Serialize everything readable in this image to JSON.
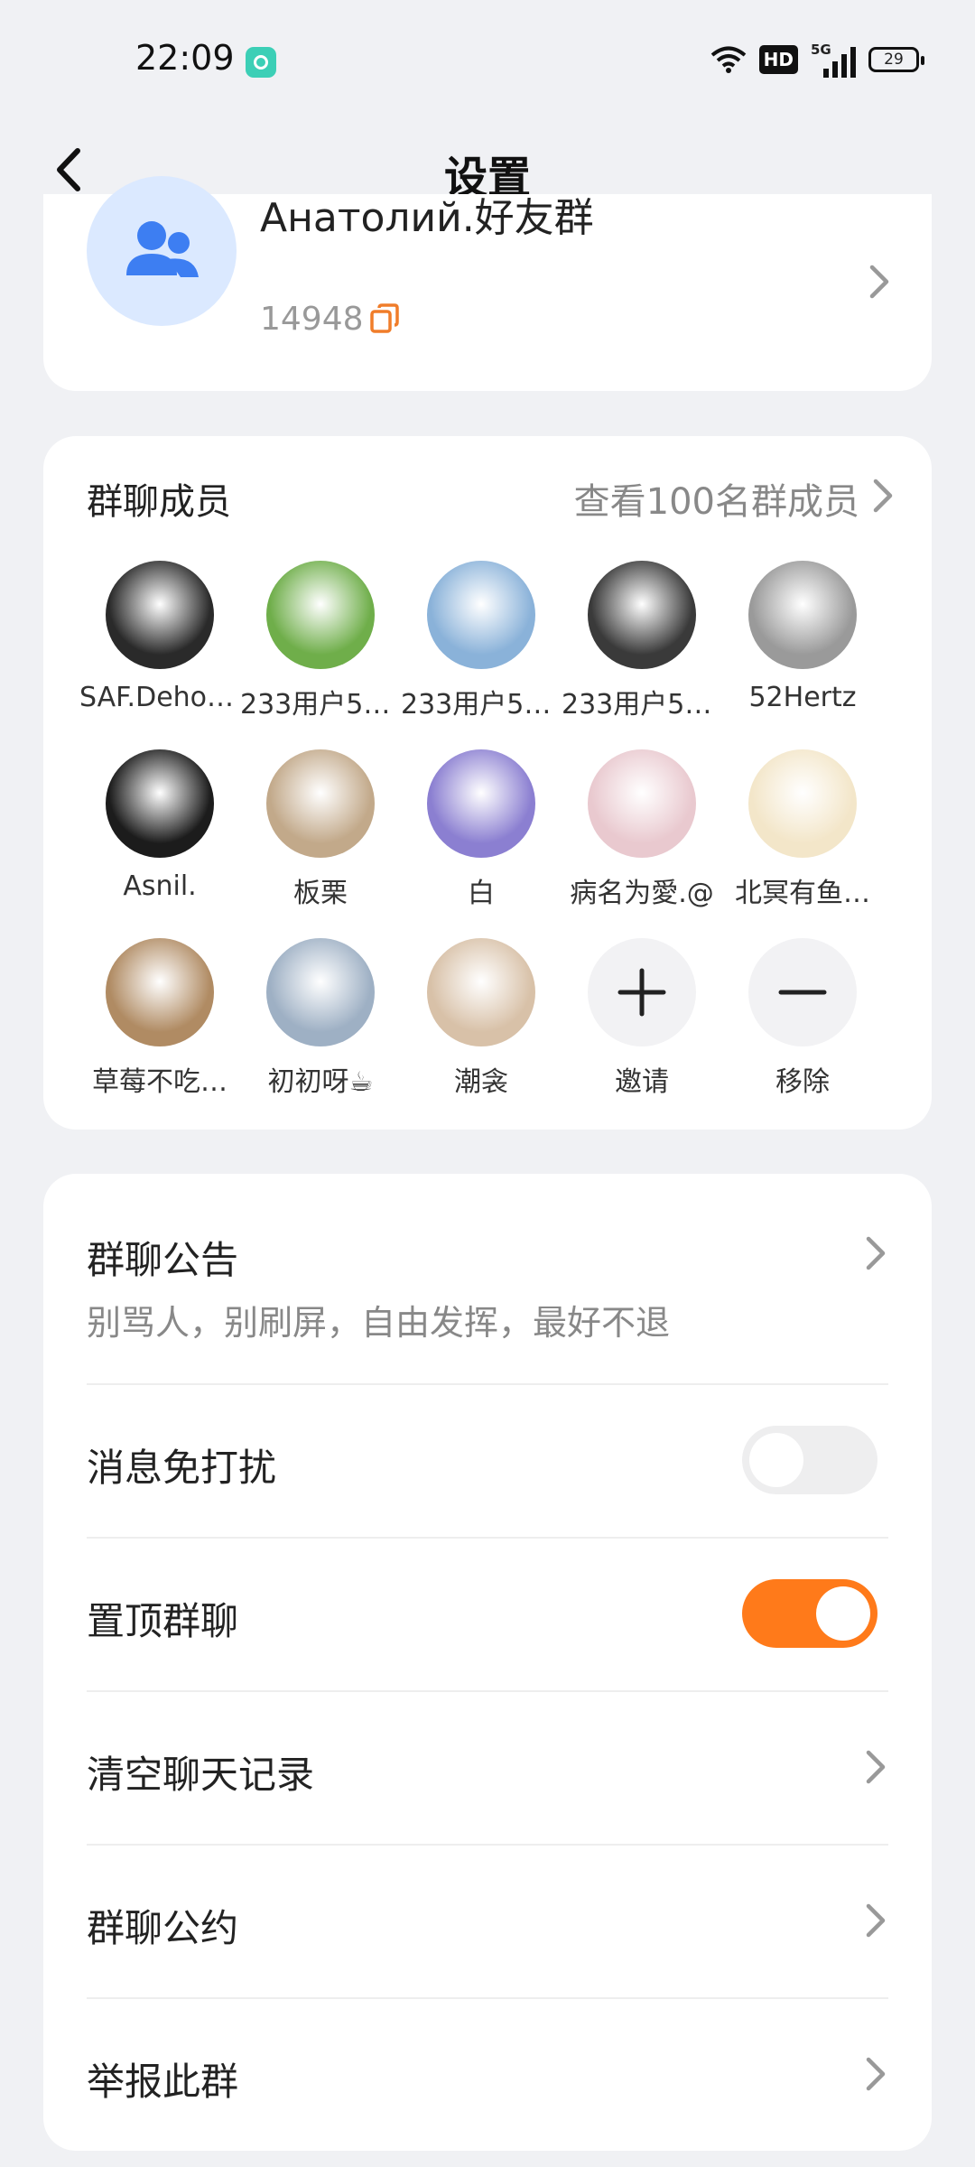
{
  "status": {
    "time": "22:09",
    "hd": "HD",
    "network": "5G",
    "battery": "29"
  },
  "header": {
    "title": "设置"
  },
  "group": {
    "name": "Анатолий.好友群",
    "id": "14948"
  },
  "members": {
    "title": "群聊成员",
    "view_all": "查看100名群成员",
    "list": [
      {
        "name": "SAF.Dehor…",
        "color": "#2a2a2a"
      },
      {
        "name": "233用户53…",
        "color": "#6fae4a"
      },
      {
        "name": "233用户50…",
        "color": "#8ab2d9"
      },
      {
        "name": "233用户51…",
        "color": "#3a3a3a"
      },
      {
        "name": "52Hertz",
        "color": "#9a9a9a"
      },
      {
        "name": "Asnil.",
        "color": "#1c1c1c"
      },
      {
        "name": "板栗",
        "color": "#c2a98a"
      },
      {
        "name": "白",
        "color": "#8b7fd1"
      },
      {
        "name": "病名为愛.@",
        "color": "#e9c9cf"
      },
      {
        "name": "北冥有鱼…",
        "color": "#f3e6c9"
      },
      {
        "name": "草莓不吃…",
        "color": "#b08b63"
      },
      {
        "name": "初初呀☕",
        "color": "#9eb0c4"
      },
      {
        "name": "潮衾",
        "color": "#d8c1a8"
      }
    ],
    "invite_label": "邀请",
    "remove_label": "移除"
  },
  "settings": {
    "announcement": {
      "label": "群聊公告",
      "text": "别骂人，别刷屏，自由发挥，最好不退"
    },
    "mute": {
      "label": "消息免打扰",
      "on": false
    },
    "pin": {
      "label": "置顶群聊",
      "on": true
    },
    "clear": {
      "label": "清空聊天记录"
    },
    "rules": {
      "label": "群聊公约"
    },
    "report": {
      "label": "举报此群"
    }
  },
  "colors": {
    "accent": "#ff7a1a",
    "toggle_off": "#eeeeef",
    "avatar_bg": "#dbe9ff",
    "avatar_icon": "#3d7ef2"
  }
}
